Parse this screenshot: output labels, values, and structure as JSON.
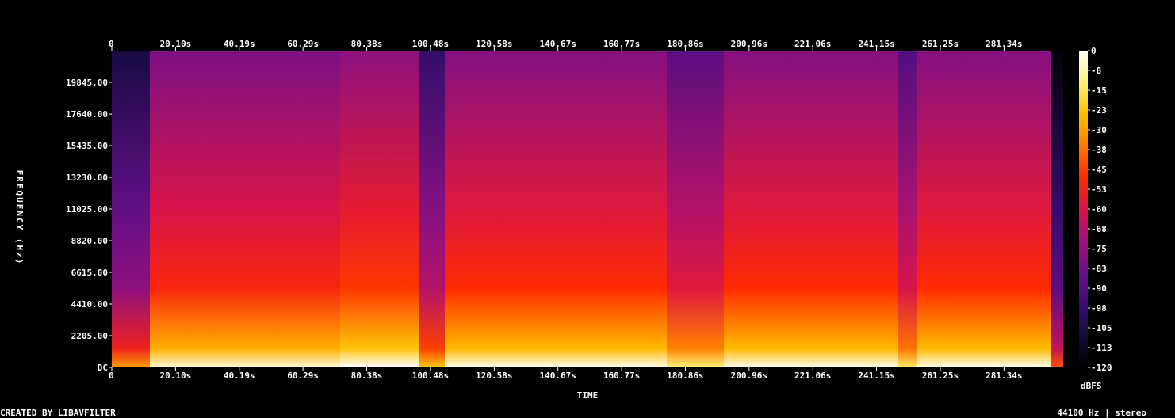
{
  "chart_data": {
    "type": "heatmap",
    "title": "",
    "xlabel": "TIME",
    "ylabel": "FREQUENCY (Hz)",
    "x_ticks": [
      "0",
      "20.10s",
      "40.19s",
      "60.29s",
      "80.38s",
      "100.48s",
      "120.58s",
      "140.67s",
      "160.77s",
      "180.86s",
      "200.96s",
      "221.06s",
      "241.15s",
      "261.25s",
      "281.34s"
    ],
    "x_tick_values": [
      0,
      20.1,
      40.19,
      60.29,
      80.38,
      100.48,
      120.58,
      140.67,
      160.77,
      180.86,
      200.96,
      221.06,
      241.15,
      261.25,
      281.34
    ],
    "xlim": [
      0,
      300
    ],
    "y_ticks": [
      "DC",
      "2205.00",
      "4410.00",
      "6615.00",
      "8820.00",
      "11025.00",
      "13230.00",
      "15435.00",
      "17640.00",
      "19845.00"
    ],
    "y_tick_values": [
      0,
      2205,
      4410,
      6615,
      8820,
      11025,
      13230,
      15435,
      17640,
      19845
    ],
    "ylim": [
      0,
      22050
    ],
    "colorbar_label": "dBFS",
    "colorbar_ticks": [
      "0",
      "-8",
      "-15",
      "-23",
      "-30",
      "-38",
      "-45",
      "-53",
      "-60",
      "-68",
      "-75",
      "-83",
      "-90",
      "-98",
      "-105",
      "-113",
      "-120"
    ],
    "colorbar_range": [
      -120,
      0
    ],
    "colormap": [
      "#000000",
      "#120b3a",
      "#3b0d73",
      "#6a0f8a",
      "#a0117a",
      "#d8144a",
      "#ff2a00",
      "#ff7a00",
      "#ffc000",
      "#fff27a",
      "#ffffff"
    ],
    "sections": [
      {
        "start": 0,
        "end": 12,
        "level": -88
      },
      {
        "start": 12,
        "end": 72,
        "level": -62
      },
      {
        "start": 72,
        "end": 97,
        "level": -58
      },
      {
        "start": 97,
        "end": 105,
        "level": -80
      },
      {
        "start": 105,
        "end": 175,
        "level": -60
      },
      {
        "start": 175,
        "end": 193,
        "level": -70
      },
      {
        "start": 193,
        "end": 248,
        "level": -60
      },
      {
        "start": 248,
        "end": 254,
        "level": -72
      },
      {
        "start": 254,
        "end": 296,
        "level": -60
      },
      {
        "start": 296,
        "end": 300,
        "level": -100
      }
    ]
  },
  "footer": {
    "left": "CREATED BY LIBAVFILTER",
    "right": "44100 Hz | stereo"
  }
}
